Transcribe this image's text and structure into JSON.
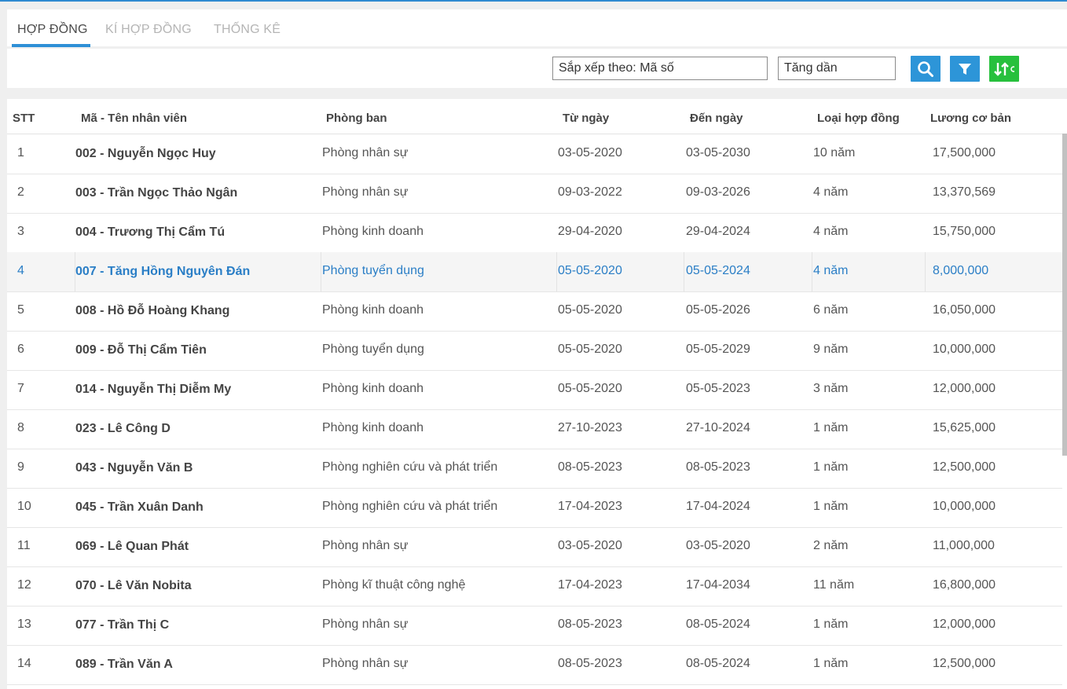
{
  "tabs": [
    {
      "label": "HỢP ĐỒNG",
      "active": true
    },
    {
      "label": "KÍ HỢP ĐỒNG",
      "active": false
    },
    {
      "label": "THỐNG KÊ",
      "active": false
    }
  ],
  "toolbar": {
    "sort_field": "Sắp xếp theo: Mã số",
    "sort_order": "Tăng dần",
    "search_icon": "search-icon",
    "filter_icon": "filter-icon",
    "sort_icon": "sort-arrows-icon"
  },
  "table": {
    "headers": [
      "STT",
      "Mã - Tên nhân viên",
      "Phòng ban",
      "Từ ngày",
      "Đến ngày",
      "Loại hợp đồng",
      "Lương cơ bản"
    ],
    "selected_index": 3,
    "rows": [
      [
        "1",
        "002 - Nguyễn Ngọc Huy",
        "Phòng nhân sự",
        "03-05-2020",
        "03-05-2030",
        "10 năm",
        "17,500,000"
      ],
      [
        "2",
        "003 - Trần Ngọc Thảo Ngân",
        "Phòng nhân sự",
        "09-03-2022",
        "09-03-2026",
        "4 năm",
        "13,370,569"
      ],
      [
        "3",
        "004 - Trương Thị Cẩm Tú",
        "Phòng kinh doanh",
        "29-04-2020",
        "29-04-2024",
        "4 năm",
        "15,750,000"
      ],
      [
        "4",
        "007 - Tăng Hồng Nguyên Đán",
        "Phòng tuyển dụng",
        "05-05-2020",
        "05-05-2024",
        "4 năm",
        "8,000,000"
      ],
      [
        "5",
        "008 - Hồ Đỗ Hoàng Khang",
        "Phòng kinh doanh",
        "05-05-2020",
        "05-05-2026",
        "6 năm",
        "16,050,000"
      ],
      [
        "6",
        "009 - Đỗ Thị Cẩm Tiên",
        "Phòng tuyển dụng",
        "05-05-2020",
        "05-05-2029",
        "9 năm",
        "10,000,000"
      ],
      [
        "7",
        "014 - Nguyễn Thị Diễm My",
        "Phòng kinh doanh",
        "05-05-2020",
        "05-05-2023",
        "3 năm",
        "12,000,000"
      ],
      [
        "8",
        "023 - Lê Công D",
        "Phòng kinh doanh",
        "27-10-2023",
        "27-10-2024",
        "1 năm",
        "15,625,000"
      ],
      [
        "9",
        "043 - Nguyễn Văn B",
        "Phòng nghiên cứu và phát triển",
        "08-05-2023",
        "08-05-2023",
        "1 năm",
        "12,500,000"
      ],
      [
        "10",
        "045 - Trần Xuân Danh",
        "Phòng nghiên cứu và phát triển",
        "17-04-2023",
        "17-04-2024",
        "1 năm",
        "10,000,000"
      ],
      [
        "11",
        "069 - Lê Quan Phát",
        "Phòng nhân sự",
        "03-05-2020",
        "03-05-2020",
        "2 năm",
        "11,000,000"
      ],
      [
        "12",
        "070 - Lê Văn Nobita",
        "Phòng kĩ thuật công nghệ",
        "17-04-2023",
        "17-04-2034",
        "11 năm",
        "16,800,000"
      ],
      [
        "13",
        "077 - Trần Thị C",
        "Phòng nhân sự",
        "08-05-2023",
        "08-05-2024",
        "1 năm",
        "12,000,000"
      ],
      [
        "14",
        "089 - Trần Văn A",
        "Phòng nhân sự",
        "08-05-2023",
        "08-05-2024",
        "1 năm",
        "12,500,000"
      ]
    ]
  },
  "colors": {
    "accent": "#2d95d8",
    "accent_green": "#27c03d",
    "selected_text": "#2a7ec6"
  }
}
